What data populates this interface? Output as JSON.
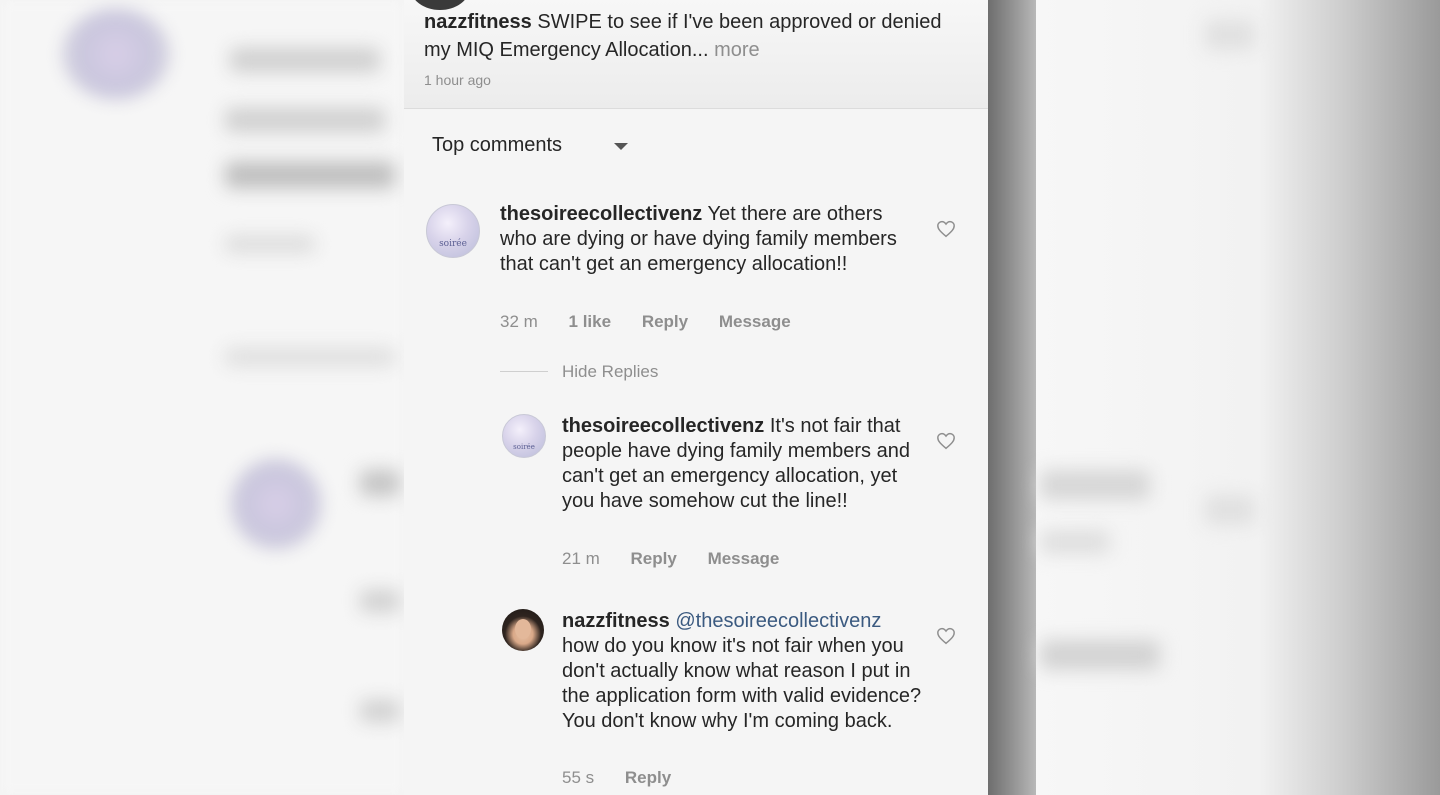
{
  "post": {
    "username": "nazzfitness",
    "caption": "SWIPE to see if I've been approved or denied my MIQ Emergency Allocation...",
    "more_label": "more",
    "time": "1 hour ago"
  },
  "sort": {
    "label": "Top comments",
    "icon": "caret-down-icon"
  },
  "comments": [
    {
      "username": "thesoireecollectivenz",
      "avatar_text": "soirée",
      "text": "Yet there are others who are dying or have dying family members that can't get an emergency allocation!!",
      "time": "32 m",
      "likes": "1 like",
      "reply_label": "Reply",
      "message_label": "Message"
    }
  ],
  "hide_replies_label": "Hide Replies",
  "replies": [
    {
      "username": "thesoireecollectivenz",
      "avatar_text": "soirée",
      "text": "It's not fair that people have dying family members and can't get an emergency allocation, yet you have somehow cut the line!!",
      "time": "21 m",
      "reply_label": "Reply",
      "message_label": "Message"
    },
    {
      "username": "nazzfitness",
      "mention": "@thesoireecollectivenz",
      "text": "how do you know it's not fair when you don't actually know what reason I put in the application form with valid evidence? You don't know why I'm coming back.",
      "time": "55 s",
      "reply_label": "Reply"
    }
  ],
  "colors": {
    "text": "#262626",
    "secondary": "#8e8e8e",
    "mention": "#3b5a80"
  }
}
